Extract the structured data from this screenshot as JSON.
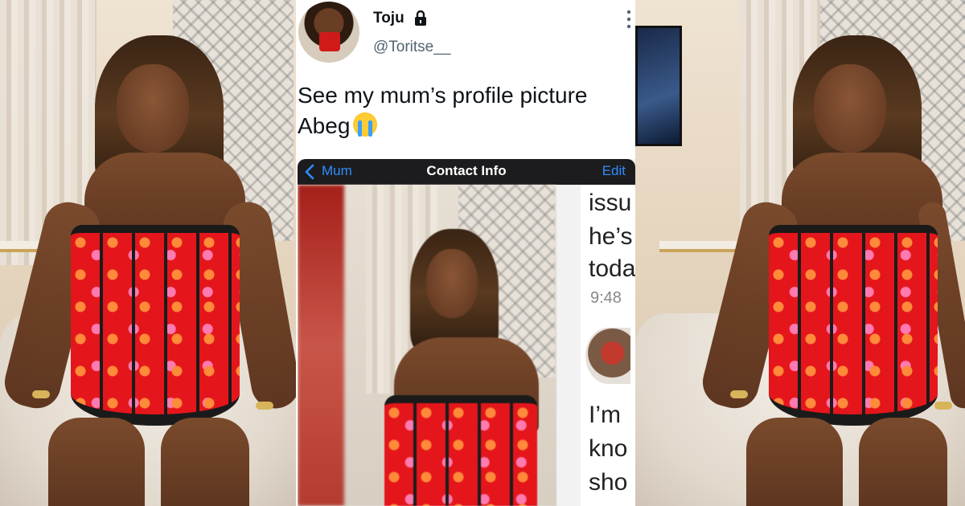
{
  "tweet": {
    "display_name": "Toju",
    "handle": "@Toritse__",
    "text_line1": "See my mum’s profile picture",
    "text_line2": "Abeg",
    "emoji": "loudly-crying-face"
  },
  "embedded_screenshot": {
    "nav": {
      "back_label": "Mum",
      "title": "Contact Info",
      "edit_label": "Edit"
    },
    "chat_fragments": [
      "issu",
      "he’s",
      "toda"
    ],
    "chat_time": "9:48",
    "chat_fragments_lower": [
      "I’m",
      "kno",
      "sho"
    ]
  },
  "colors": {
    "ios_link_blue": "#2f8cff",
    "corset_red": "#e4161b",
    "twitter_text": "#0f1419",
    "twitter_secondary": "#536471"
  }
}
